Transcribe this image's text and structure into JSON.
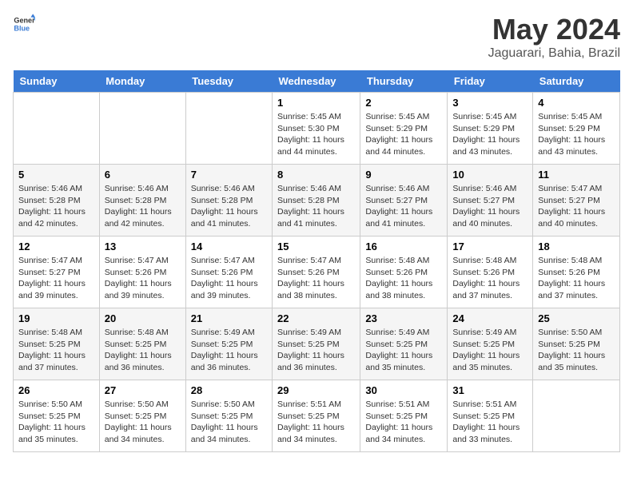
{
  "logo": {
    "general": "General",
    "blue": "Blue"
  },
  "header": {
    "month_year": "May 2024",
    "location": "Jaguarari, Bahia, Brazil"
  },
  "days_of_week": [
    "Sunday",
    "Monday",
    "Tuesday",
    "Wednesday",
    "Thursday",
    "Friday",
    "Saturday"
  ],
  "weeks": [
    [
      {
        "day": "",
        "info": ""
      },
      {
        "day": "",
        "info": ""
      },
      {
        "day": "",
        "info": ""
      },
      {
        "day": "1",
        "info": "Sunrise: 5:45 AM\nSunset: 5:30 PM\nDaylight: 11 hours and 44 minutes."
      },
      {
        "day": "2",
        "info": "Sunrise: 5:45 AM\nSunset: 5:29 PM\nDaylight: 11 hours and 44 minutes."
      },
      {
        "day": "3",
        "info": "Sunrise: 5:45 AM\nSunset: 5:29 PM\nDaylight: 11 hours and 43 minutes."
      },
      {
        "day": "4",
        "info": "Sunrise: 5:45 AM\nSunset: 5:29 PM\nDaylight: 11 hours and 43 minutes."
      }
    ],
    [
      {
        "day": "5",
        "info": "Sunrise: 5:46 AM\nSunset: 5:28 PM\nDaylight: 11 hours and 42 minutes."
      },
      {
        "day": "6",
        "info": "Sunrise: 5:46 AM\nSunset: 5:28 PM\nDaylight: 11 hours and 42 minutes."
      },
      {
        "day": "7",
        "info": "Sunrise: 5:46 AM\nSunset: 5:28 PM\nDaylight: 11 hours and 41 minutes."
      },
      {
        "day": "8",
        "info": "Sunrise: 5:46 AM\nSunset: 5:28 PM\nDaylight: 11 hours and 41 minutes."
      },
      {
        "day": "9",
        "info": "Sunrise: 5:46 AM\nSunset: 5:27 PM\nDaylight: 11 hours and 41 minutes."
      },
      {
        "day": "10",
        "info": "Sunrise: 5:46 AM\nSunset: 5:27 PM\nDaylight: 11 hours and 40 minutes."
      },
      {
        "day": "11",
        "info": "Sunrise: 5:47 AM\nSunset: 5:27 PM\nDaylight: 11 hours and 40 minutes."
      }
    ],
    [
      {
        "day": "12",
        "info": "Sunrise: 5:47 AM\nSunset: 5:27 PM\nDaylight: 11 hours and 39 minutes."
      },
      {
        "day": "13",
        "info": "Sunrise: 5:47 AM\nSunset: 5:26 PM\nDaylight: 11 hours and 39 minutes."
      },
      {
        "day": "14",
        "info": "Sunrise: 5:47 AM\nSunset: 5:26 PM\nDaylight: 11 hours and 39 minutes."
      },
      {
        "day": "15",
        "info": "Sunrise: 5:47 AM\nSunset: 5:26 PM\nDaylight: 11 hours and 38 minutes."
      },
      {
        "day": "16",
        "info": "Sunrise: 5:48 AM\nSunset: 5:26 PM\nDaylight: 11 hours and 38 minutes."
      },
      {
        "day": "17",
        "info": "Sunrise: 5:48 AM\nSunset: 5:26 PM\nDaylight: 11 hours and 37 minutes."
      },
      {
        "day": "18",
        "info": "Sunrise: 5:48 AM\nSunset: 5:26 PM\nDaylight: 11 hours and 37 minutes."
      }
    ],
    [
      {
        "day": "19",
        "info": "Sunrise: 5:48 AM\nSunset: 5:25 PM\nDaylight: 11 hours and 37 minutes."
      },
      {
        "day": "20",
        "info": "Sunrise: 5:48 AM\nSunset: 5:25 PM\nDaylight: 11 hours and 36 minutes."
      },
      {
        "day": "21",
        "info": "Sunrise: 5:49 AM\nSunset: 5:25 PM\nDaylight: 11 hours and 36 minutes."
      },
      {
        "day": "22",
        "info": "Sunrise: 5:49 AM\nSunset: 5:25 PM\nDaylight: 11 hours and 36 minutes."
      },
      {
        "day": "23",
        "info": "Sunrise: 5:49 AM\nSunset: 5:25 PM\nDaylight: 11 hours and 35 minutes."
      },
      {
        "day": "24",
        "info": "Sunrise: 5:49 AM\nSunset: 5:25 PM\nDaylight: 11 hours and 35 minutes."
      },
      {
        "day": "25",
        "info": "Sunrise: 5:50 AM\nSunset: 5:25 PM\nDaylight: 11 hours and 35 minutes."
      }
    ],
    [
      {
        "day": "26",
        "info": "Sunrise: 5:50 AM\nSunset: 5:25 PM\nDaylight: 11 hours and 35 minutes."
      },
      {
        "day": "27",
        "info": "Sunrise: 5:50 AM\nSunset: 5:25 PM\nDaylight: 11 hours and 34 minutes."
      },
      {
        "day": "28",
        "info": "Sunrise: 5:50 AM\nSunset: 5:25 PM\nDaylight: 11 hours and 34 minutes."
      },
      {
        "day": "29",
        "info": "Sunrise: 5:51 AM\nSunset: 5:25 PM\nDaylight: 11 hours and 34 minutes."
      },
      {
        "day": "30",
        "info": "Sunrise: 5:51 AM\nSunset: 5:25 PM\nDaylight: 11 hours and 34 minutes."
      },
      {
        "day": "31",
        "info": "Sunrise: 5:51 AM\nSunset: 5:25 PM\nDaylight: 11 hours and 33 minutes."
      },
      {
        "day": "",
        "info": ""
      }
    ]
  ]
}
